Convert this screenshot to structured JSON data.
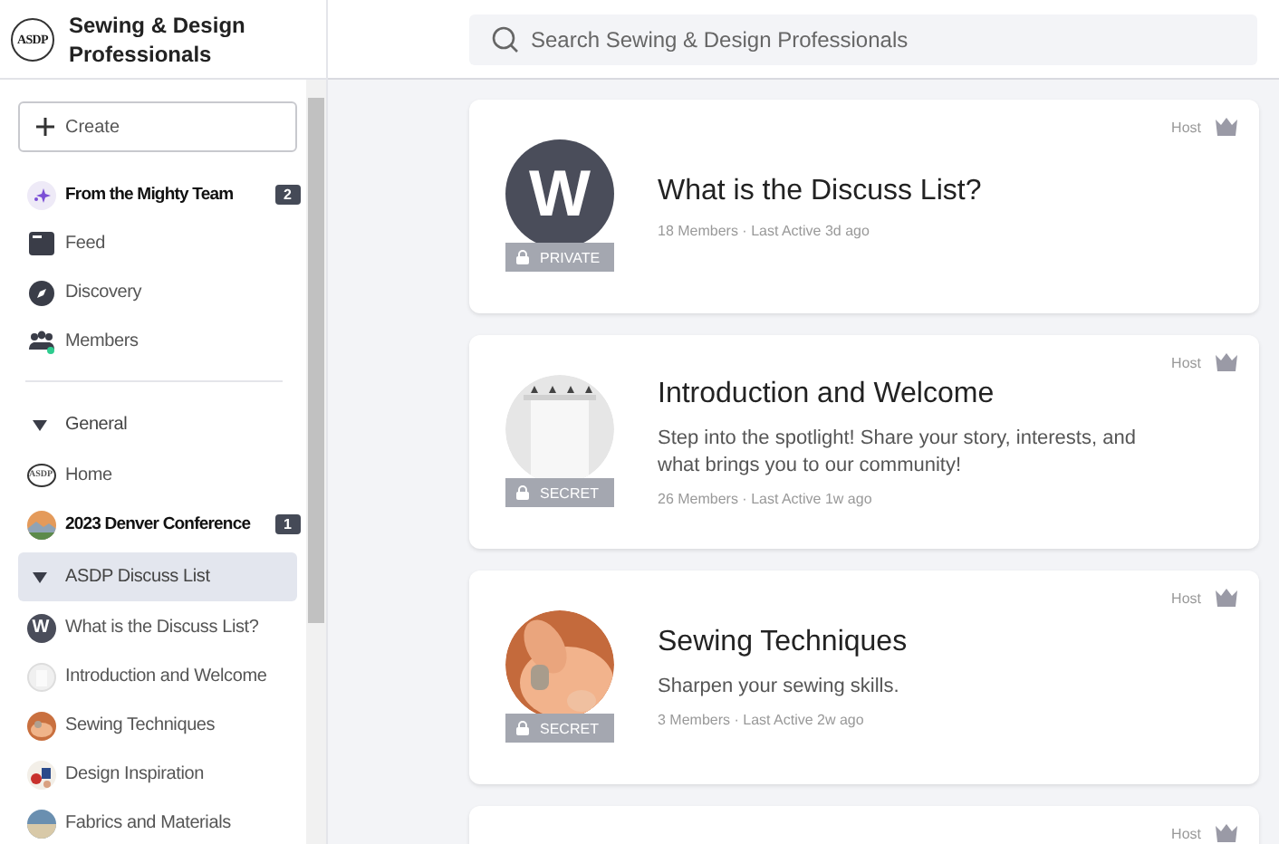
{
  "brand": {
    "name": "Sewing & Design Professionals",
    "logo_text": "ASDP"
  },
  "search": {
    "placeholder": "Search Sewing & Design Professionals"
  },
  "sidebar": {
    "create_label": "Create",
    "items": [
      {
        "label": "From the Mighty Team",
        "unread": true,
        "badge": "2"
      },
      {
        "label": "Feed",
        "unread": false
      },
      {
        "label": "Discovery",
        "unread": false
      },
      {
        "label": "Members",
        "unread": false
      }
    ],
    "sections": [
      {
        "label": "General",
        "expanded": true,
        "selected": false,
        "items": [
          {
            "label": "Home",
            "logo_text": "ASDP",
            "unread": false
          },
          {
            "label": "2023 Denver Conference",
            "unread": true,
            "badge": "1"
          }
        ]
      },
      {
        "label": "ASDP Discuss List",
        "expanded": true,
        "selected": true,
        "items": [
          {
            "label": "What is the Discuss List?",
            "letter": "W",
            "unread": false
          },
          {
            "label": "Introduction and Welcome",
            "unread": false
          },
          {
            "label": "Sewing Techniques",
            "unread": false
          },
          {
            "label": "Design Inspiration",
            "unread": false
          },
          {
            "label": "Fabrics and Materials",
            "unread": false
          }
        ]
      }
    ]
  },
  "cards": [
    {
      "title": "What is the Discuss List?",
      "meta": "18 Members · Last Active 3d ago",
      "visibility": "PRIVATE",
      "host": "Host",
      "avatar": {
        "kind": "letter",
        "letter": "W"
      }
    },
    {
      "title": "Introduction and Welcome",
      "description": "Step into the spotlight! Share your story, interests, and what brings you to our community!",
      "meta": "26 Members · Last Active 1w ago",
      "visibility": "SECRET",
      "host": "Host"
    },
    {
      "title": "Sewing Techniques",
      "description": "Sharpen your sewing skills.",
      "meta": "3 Members · Last Active 2w ago",
      "visibility": "SECRET",
      "host": "Host"
    },
    {
      "host": "Host"
    }
  ]
}
